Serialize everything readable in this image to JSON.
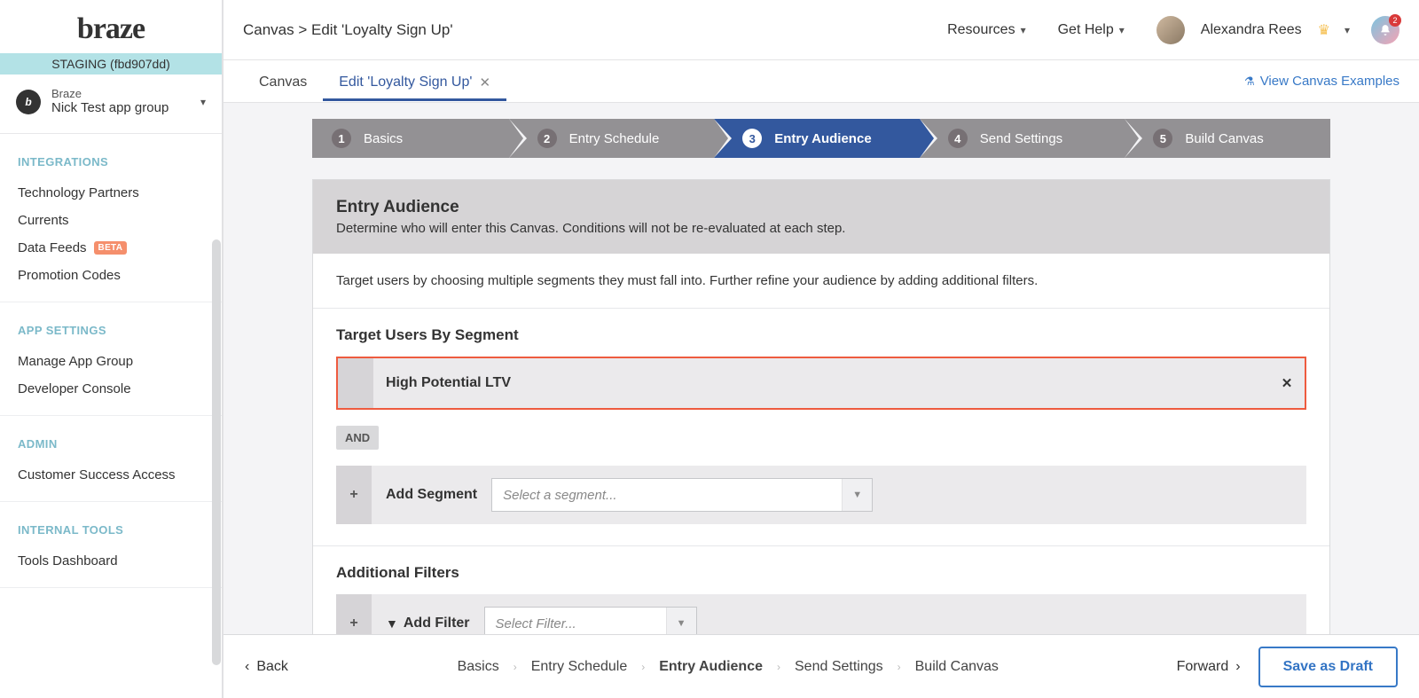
{
  "logo_text": "braze",
  "staging_label": "STAGING (fbd907dd)",
  "app_group": {
    "brand": "Braze",
    "name": "Nick Test app group"
  },
  "sidebar": {
    "sections": [
      {
        "heading": "INTEGRATIONS",
        "items": [
          {
            "label": "Technology Partners"
          },
          {
            "label": "Currents"
          },
          {
            "label": "Data Feeds",
            "badge": "BETA"
          },
          {
            "label": "Promotion Codes"
          }
        ]
      },
      {
        "heading": "APP SETTINGS",
        "items": [
          {
            "label": "Manage App Group"
          },
          {
            "label": "Developer Console"
          }
        ]
      },
      {
        "heading": "ADMIN",
        "items": [
          {
            "label": "Customer Success Access"
          }
        ]
      },
      {
        "heading": "INTERNAL TOOLS",
        "items": [
          {
            "label": "Tools Dashboard"
          }
        ]
      }
    ]
  },
  "breadcrumb": "Canvas > Edit 'Loyalty Sign Up'",
  "top_links": {
    "resources": "Resources",
    "get_help": "Get Help"
  },
  "user": {
    "name": "Alexandra Rees",
    "notif_count": "2"
  },
  "tabs": {
    "canvas": "Canvas",
    "edit": "Edit 'Loyalty Sign Up'"
  },
  "view_examples": "View Canvas Examples",
  "steps": [
    {
      "num": "1",
      "label": "Basics"
    },
    {
      "num": "2",
      "label": "Entry Schedule"
    },
    {
      "num": "3",
      "label": "Entry Audience"
    },
    {
      "num": "4",
      "label": "Send Settings"
    },
    {
      "num": "5",
      "label": "Build Canvas"
    }
  ],
  "panel": {
    "title": "Entry Audience",
    "subtitle": "Determine who will enter this Canvas. Conditions will not be re-evaluated at each step.",
    "instruction": "Target users by choosing multiple segments they must fall into. Further refine your audience by adding additional filters.",
    "segment_section": "Target Users By Segment",
    "selected_segment": "High Potential LTV",
    "and_label": "AND",
    "add_segment_label": "Add Segment",
    "segment_placeholder": "Select a segment...",
    "filters_section": "Additional Filters",
    "add_filter_label": "Add Filter",
    "filter_placeholder": "Select Filter..."
  },
  "footer": {
    "back": "Back",
    "forward": "Forward",
    "save_draft": "Save as Draft",
    "steps": [
      "Basics",
      "Entry Schedule",
      "Entry Audience",
      "Send Settings",
      "Build Canvas"
    ]
  }
}
